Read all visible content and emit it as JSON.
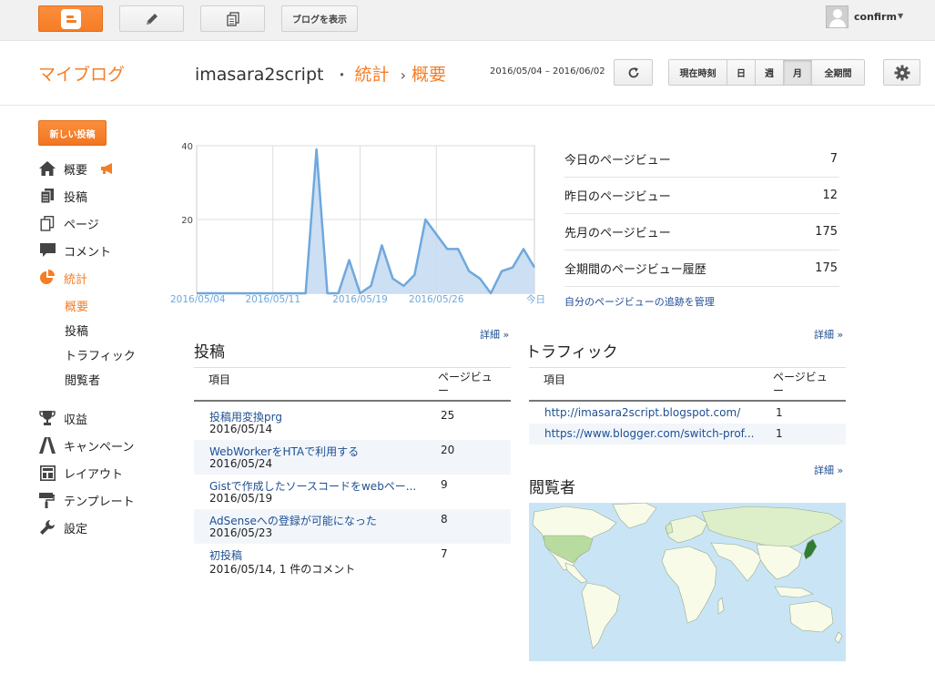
{
  "topbar": {
    "view_blog_label": "ブログを表示",
    "user_name": "confirm"
  },
  "header": {
    "my_blog": "マイブログ",
    "blog_name": "imasara2script",
    "dot": "・",
    "section": "統計",
    "arrow": "›",
    "page": "概要",
    "date_range": "2016/05/04 – 2016/06/02",
    "periods": [
      {
        "label": "現在時刻",
        "active": false
      },
      {
        "label": "日",
        "active": false
      },
      {
        "label": "週",
        "active": false
      },
      {
        "label": "月",
        "active": true
      },
      {
        "label": "全期間",
        "active": false
      }
    ]
  },
  "sidebar": {
    "new_post": "新しい投稿",
    "items": [
      {
        "label": "概要",
        "icon": "home-icon"
      },
      {
        "label": "投稿",
        "icon": "posts-icon"
      },
      {
        "label": "ページ",
        "icon": "pages-icon"
      },
      {
        "label": "コメント",
        "icon": "comment-icon"
      },
      {
        "label": "統計",
        "icon": "stats-pie-icon",
        "active": true
      },
      {
        "label": "収益",
        "icon": "trophy-icon"
      },
      {
        "label": "キャンペーン",
        "icon": "campaign-icon"
      },
      {
        "label": "レイアウト",
        "icon": "layout-icon"
      },
      {
        "label": "テンプレート",
        "icon": "template-icon"
      },
      {
        "label": "設定",
        "icon": "wrench-icon"
      }
    ],
    "sub_items": [
      {
        "label": "概要",
        "active": true
      },
      {
        "label": "投稿",
        "active": false
      },
      {
        "label": "トラフィック",
        "active": false
      },
      {
        "label": "閲覧者",
        "active": false
      }
    ]
  },
  "chart_data": {
    "type": "area",
    "x_labels": [
      "2016/05/04",
      "2016/05/11",
      "2016/05/19",
      "2016/05/26",
      "今日"
    ],
    "values": [
      0,
      0,
      0,
      0,
      0,
      0,
      0,
      0,
      0,
      0,
      0,
      39,
      0,
      0,
      9,
      0,
      2,
      13,
      4,
      2,
      5,
      20,
      16,
      12,
      12,
      6,
      4,
      0,
      6,
      7,
      12,
      7
    ],
    "ylim": [
      0,
      40
    ],
    "yticks": [
      20,
      40
    ],
    "colors": {
      "line": "#6fa8dc",
      "fill": "#c6dcf2",
      "grid": "#dddddd"
    }
  },
  "pageviews": {
    "rows": [
      {
        "label": "今日のページビュー",
        "value": "7"
      },
      {
        "label": "昨日のページビュー",
        "value": "12"
      },
      {
        "label": "先月のページビュー",
        "value": "175"
      },
      {
        "label": "全期間のページビュー履歴",
        "value": "175"
      }
    ],
    "manage_link": "自分のページビューの追跡を管理"
  },
  "more_label": "詳細 »",
  "posts": {
    "title": "投稿",
    "col_item": "項目",
    "col_views": "ページビュー",
    "rows": [
      {
        "title": "投稿用変換prg",
        "date": "2016/05/14",
        "views": "25"
      },
      {
        "title": "WebWorkerをHTAで利用する",
        "date": "2016/05/24",
        "views": "20"
      },
      {
        "title": "Gistで作成したソースコードをwebペー...",
        "date": "2016/05/19",
        "views": "9"
      },
      {
        "title": "AdSenseへの登録が可能になった",
        "date": "2016/05/23",
        "views": "8"
      },
      {
        "title": "初投稿",
        "date": "2016/05/14, 1 件のコメント",
        "views": "7"
      }
    ]
  },
  "traffic": {
    "title": "トラフィック",
    "col_item": "項目",
    "col_views": "ページビュー",
    "rows": [
      {
        "url": "http://imasara2script.blogspot.com/",
        "views": "1"
      },
      {
        "url": "https://www.blogger.com/switch-prof...",
        "views": "1"
      }
    ]
  },
  "audience": {
    "title": "閲覧者"
  }
}
